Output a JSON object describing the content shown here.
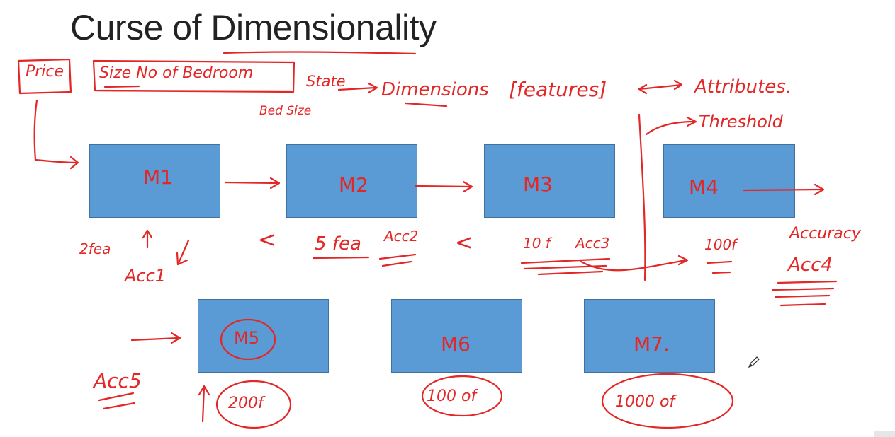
{
  "slide": {
    "title": "Curse of Dimensionality",
    "colors": {
      "box": "#5b9bd5",
      "ink": "#e32626",
      "title": "#222222"
    }
  },
  "annotations": {
    "price": "Price",
    "size_bedroom": "Size  No of Bedroom",
    "state": "State",
    "dimensions": "Dimensions",
    "features": "[features]",
    "attributes": "Attributes.",
    "bed_size": "Bed Size",
    "threshold": "Threshold",
    "feat_2": "2fea",
    "acc1": "Acc1",
    "feat_5": "5 fea",
    "acc2": "Acc2",
    "feat_10": "10 f",
    "acc3": "Acc3",
    "feat_100_m4": "100f",
    "accuracy": "Accuracy",
    "acc4": "Acc4",
    "acc5": "Acc5",
    "feat_200": "200f",
    "feat_100_m6": "100 of",
    "feat_1000": "1000 of",
    "lt1": "<",
    "lt2": "<"
  },
  "models": {
    "m1": "M1",
    "m2": "M2",
    "m3": "M3",
    "m4": "M4",
    "m5": "M5",
    "m6": "M6",
    "m7": "M7."
  },
  "icons": {
    "cursor": "pen-cursor-icon"
  }
}
